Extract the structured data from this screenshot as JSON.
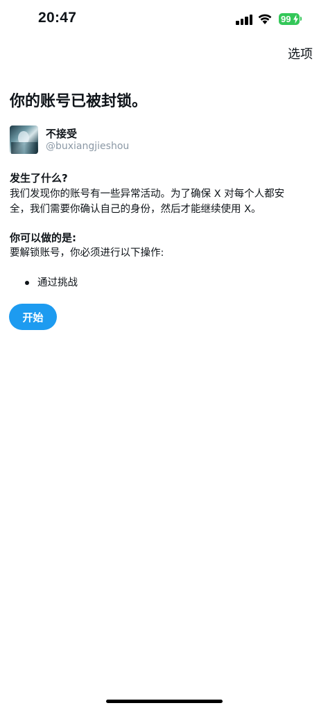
{
  "status_bar": {
    "time": "20:47",
    "battery_level": "99",
    "battery_color": "#34c759"
  },
  "header": {
    "options_label": "选项"
  },
  "page": {
    "title": "你的账号已被封锁。"
  },
  "account": {
    "display_name": "不接受",
    "handle": "@buxiangjieshou"
  },
  "what_happened": {
    "heading": "发生了什么?",
    "line1": "我们发现你的账号有一些异常活动。为了确保 X 对每个人都安",
    "line2": "全，我们需要你确认自己的身份，然后才能继续使用 X。"
  },
  "what_you_can_do": {
    "heading": "你可以做的是:",
    "text": "要解锁账号，你必须进行以下操作:",
    "steps": [
      "通过挑战"
    ]
  },
  "actions": {
    "start_label": "开始",
    "accent_color": "#1d9bf0"
  },
  "icons": {
    "signal": "cellular-signal-icon",
    "wifi": "wifi-icon",
    "battery": "battery-charging-icon"
  }
}
